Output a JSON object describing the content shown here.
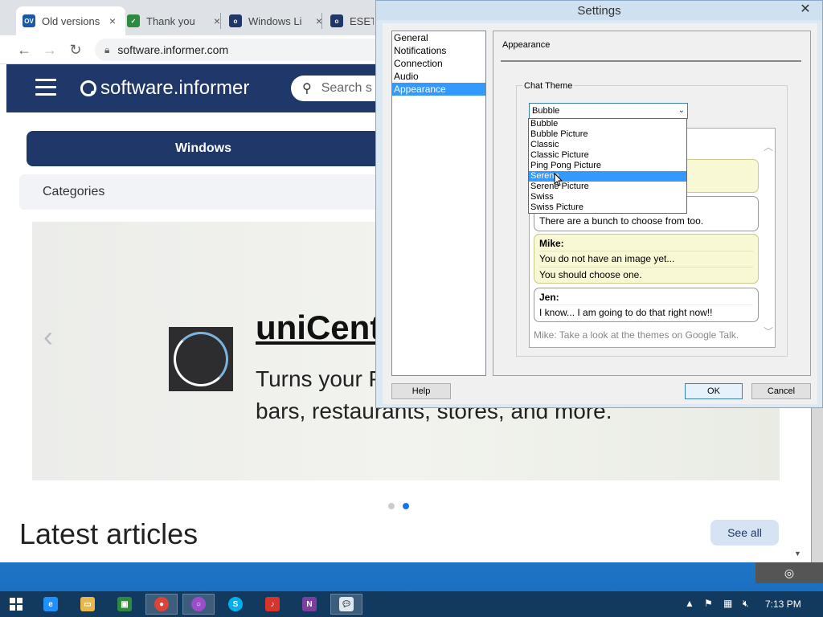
{
  "browser": {
    "tabs": [
      {
        "favicon": "OV",
        "favicon_color": "#1a5aa5",
        "title": "Old versions",
        "active": true
      },
      {
        "favicon": "✓",
        "favicon_color": "#2e8b3d",
        "title": "Thank you",
        "active": false
      },
      {
        "favicon": "o",
        "favicon_color": "#1f3769",
        "title": "Windows Li",
        "active": false
      },
      {
        "favicon": "o",
        "favicon_color": "#1f3769",
        "title": "ESET N",
        "active": false
      }
    ],
    "url": "software.informer.com"
  },
  "site": {
    "logo": "software.informer",
    "search_placeholder": "Search s",
    "windows_label": "Windows",
    "categories_label": "Categories",
    "carousel": {
      "app_name": "uniCent",
      "description_line1": "Turns your P",
      "description_line2": "bars, restaurants, stores, and more.",
      "prev_icon": "‹",
      "active_dot": 2
    },
    "latest_title": "Latest articles",
    "see_all_label": "See all"
  },
  "settings": {
    "title": "Settings",
    "categories": [
      "General",
      "Notifications",
      "Connection",
      "Audio",
      "Appearance"
    ],
    "selected_category": "Appearance",
    "panel_title": "Appearance",
    "group_label": "Chat Theme",
    "selected_theme": "Bubble",
    "theme_options": [
      "Bubble",
      "Bubble Picture",
      "Classic",
      "Classic Picture",
      "Ping Pong Picture",
      "Serene",
      "Serene Picture",
      "Swiss",
      "Swiss Picture"
    ],
    "highlighted_option": "Serene",
    "preview": {
      "msg1_line": "There are a bunch to choose from too.",
      "msg2_sender": "Mike:",
      "msg2_line1": "You do not have an image yet...",
      "msg2_line2": "You should choose one.",
      "msg3_sender": "Jen:",
      "msg3_line": "I know... I am going to do that right now!!",
      "status_line": "Mike: Take a look at the themes on Google Talk."
    },
    "help_label": "Help",
    "ok_label": "OK",
    "cancel_label": "Cancel"
  },
  "taskbar": {
    "clock": "7:13 PM"
  },
  "colors": {
    "site_navy": "#1f3769",
    "selection_blue": "#3399ff",
    "bubble_yellow": "#f8f8d4"
  }
}
